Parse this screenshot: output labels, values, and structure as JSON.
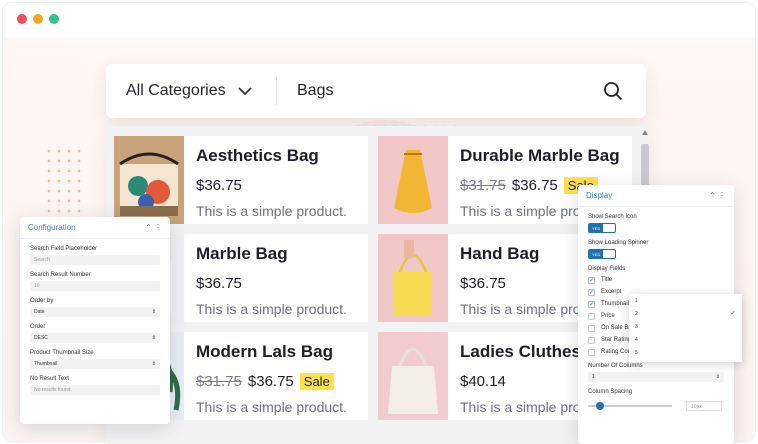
{
  "window_dots": [
    "#ee4f61",
    "#f5a623",
    "#32c48d"
  ],
  "search": {
    "category": "All Categories",
    "query": "Bags",
    "icons": {
      "chevron": "chevron-down-icon",
      "search": "search-icon"
    }
  },
  "products": [
    {
      "title": "Aesthetics Bag",
      "price": "$36.75",
      "old_price": "",
      "sale": "",
      "desc": "This is a simple product."
    },
    {
      "title": "Durable Marble Bag",
      "price": "$36.75",
      "old_price": "$31.75",
      "sale": "Sale",
      "desc": "This is a simple product."
    },
    {
      "title": "Marble Bag",
      "price": "$36.75",
      "old_price": "",
      "sale": "",
      "desc": "This is a simple product."
    },
    {
      "title": "Hand Bag",
      "price": "$36.75",
      "old_price": "",
      "sale": "",
      "desc": "This is a simple product."
    },
    {
      "title": "Modern Lals Bag",
      "price": "$36.75",
      "old_price": "$31.75",
      "sale": "Sale",
      "desc": "This is a simple product."
    },
    {
      "title": "Ladies Cluthes",
      "price": "$40.14",
      "old_price": "",
      "sale": "",
      "desc": "This is a simple product."
    }
  ],
  "config_panel": {
    "title": "Configuration",
    "fields": [
      {
        "label": "Search Field Placeholder",
        "value": "Search"
      },
      {
        "label": "Search Result Number",
        "value": "10"
      },
      {
        "label": "Order by",
        "value": "Date"
      },
      {
        "label": "Order",
        "value": "DESC"
      },
      {
        "label": "Product Thumbnail Size",
        "value": "Thumbnail"
      },
      {
        "label": "No Result Text",
        "value": "No results found"
      }
    ]
  },
  "display_panel": {
    "title": "Display",
    "show_search_icon": {
      "label": "Show Search Icon",
      "toggle": "YES"
    },
    "show_loading_spinner": {
      "label": "Show Loading Spinner",
      "toggle": "YES"
    },
    "display_fields_label": "Display Fields",
    "fields": [
      {
        "label": "Title",
        "checked": true
      },
      {
        "label": "Excerpt",
        "checked": true
      },
      {
        "label": "Thumbnail",
        "checked": true
      },
      {
        "label": "Price",
        "checked": false
      },
      {
        "label": "On Sale Ba",
        "checked": false
      },
      {
        "label": "Star Rating",
        "checked": false
      },
      {
        "label": "Rating Count",
        "checked": false
      }
    ],
    "columns_dropdown": [
      "1",
      "2",
      "3",
      "4",
      "5"
    ],
    "columns_label": "Number Of Columns",
    "columns_value": "1",
    "spacing_label": "Column Spacing",
    "spacing_value": "10px"
  }
}
